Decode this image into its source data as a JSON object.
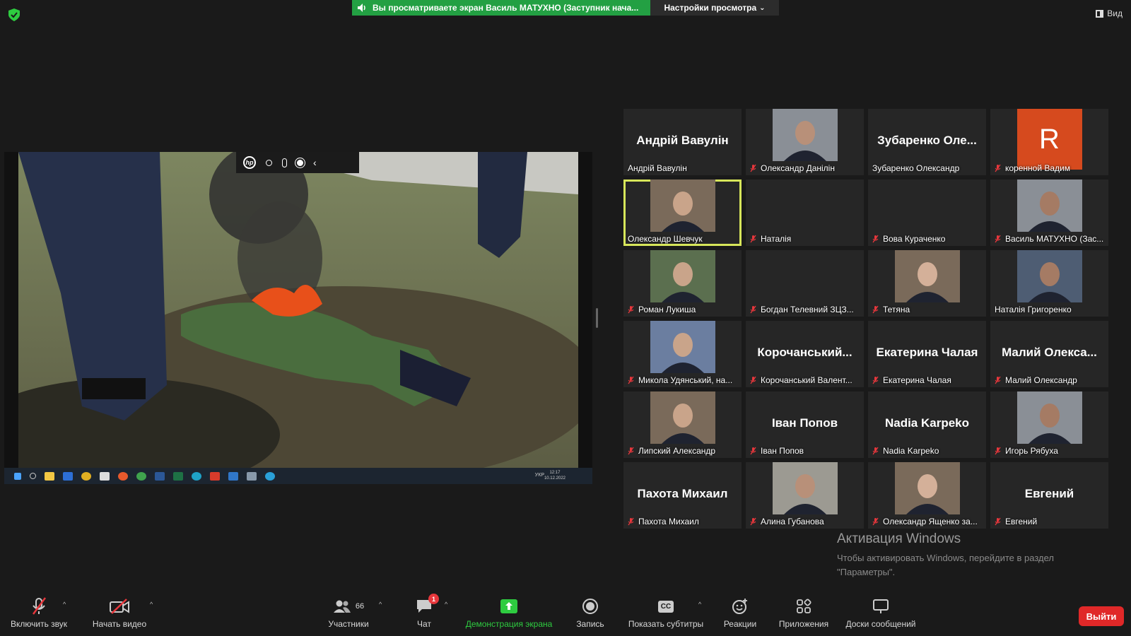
{
  "top": {
    "banner": "Вы просматриваете экран Василь МАТУХНО (Заступник нача...",
    "view_settings": "Настройки просмотра",
    "view_button": "Вид"
  },
  "shared_screen": {
    "taskbar": {
      "lang": "УКР",
      "time": "12:17",
      "date": "10.12.2022"
    }
  },
  "gallery": [
    {
      "display": "Андрій Вавулін",
      "name": "Андрій Вавулін",
      "muted": false,
      "video": false
    },
    {
      "display": "",
      "name": "Олександр Данілін",
      "muted": true,
      "video": true
    },
    {
      "display": "Зубаренко Оле...",
      "name": "Зубаренко Олександр",
      "muted": false,
      "video": false
    },
    {
      "display": "R",
      "name": "коренной Вадим",
      "muted": true,
      "video": false,
      "letter_avatar": true,
      "avatar_color": "#d64a1e"
    },
    {
      "display": "",
      "name": "Олександр Шевчук",
      "muted": false,
      "video": true,
      "active": true
    },
    {
      "display": "",
      "name": "Наталія",
      "muted": true,
      "video": false
    },
    {
      "display": "",
      "name": "Вова Кураченко",
      "muted": true,
      "video": false
    },
    {
      "display": "",
      "name": "Василь МАТУХНО (Зас...",
      "muted": true,
      "video": true
    },
    {
      "display": "",
      "name": "Роман Лукиша",
      "muted": true,
      "video": true
    },
    {
      "display": "",
      "name": "Богдан Телевний ЗЦЗ...",
      "muted": true,
      "video": false
    },
    {
      "display": "",
      "name": "Тетяна",
      "muted": true,
      "video": true
    },
    {
      "display": "",
      "name": "Наталія Григоренко",
      "muted": false,
      "video": true
    },
    {
      "display": "",
      "name": "Микола Удянський, на...",
      "muted": true,
      "video": true
    },
    {
      "display": "Корочанський...",
      "name": "Корочанський Валент...",
      "muted": true,
      "video": false
    },
    {
      "display": "Екатерина Чалая",
      "name": "Екатерина Чалая",
      "muted": true,
      "video": false
    },
    {
      "display": "Малий Олекса...",
      "name": "Малий Олександр",
      "muted": true,
      "video": false
    },
    {
      "display": "",
      "name": "Липский Александр",
      "muted": true,
      "video": true
    },
    {
      "display": "Іван Попов",
      "name": "Іван Попов",
      "muted": true,
      "video": false
    },
    {
      "display": "Nadia Karpeko",
      "name": "Nadia Karpeko",
      "muted": true,
      "video": false
    },
    {
      "display": "",
      "name": "Игорь Рябуха",
      "muted": true,
      "video": true
    },
    {
      "display": "Пахота Михаил",
      "name": "Пахота Михаил",
      "muted": true,
      "video": false
    },
    {
      "display": "",
      "name": "Алина Губанова",
      "muted": true,
      "video": true
    },
    {
      "display": "",
      "name": "Олександр Ященко за...",
      "muted": true,
      "video": true
    },
    {
      "display": "Евгений",
      "name": "Евгений",
      "muted": true,
      "video": false
    }
  ],
  "watermark": {
    "title": "Активация Windows",
    "subtitle": "Чтобы активировать Windows, перейдите в раздел \"Параметры\"."
  },
  "toolbar": {
    "unmute": "Включить звук",
    "start_video": "Начать видео",
    "participants": "Участники",
    "participants_count": "66",
    "chat": "Чат",
    "chat_badge": "1",
    "share_screen": "Демонстрация экрана",
    "record": "Запись",
    "captions": "Показать субтитры",
    "captions_icon_text": "CC",
    "reactions": "Реакции",
    "apps": "Приложения",
    "whiteboards": "Доски сообщений",
    "leave": "Выйти"
  },
  "colors": {
    "accent_green": "#23a043",
    "leave_red": "#e02828",
    "active_speaker": "#d7e65a",
    "mic_off": "#e8373c"
  }
}
